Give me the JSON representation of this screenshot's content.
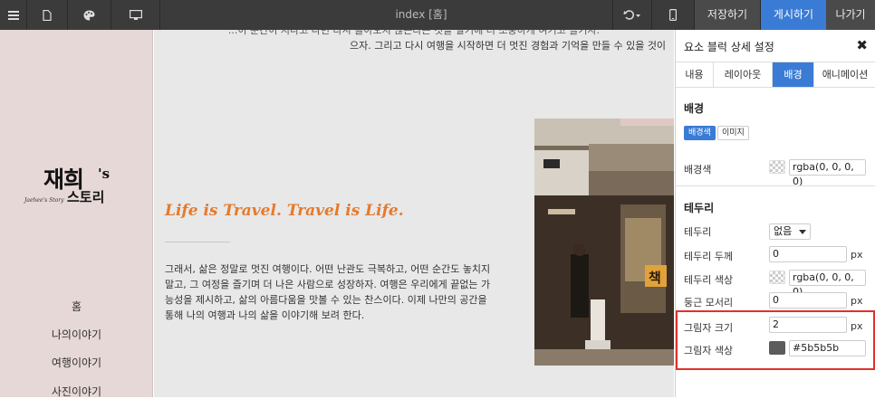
{
  "topbar": {
    "title": "index [홈]",
    "menu_icon": "hamburger-menu-icon",
    "page_icon": "document-icon",
    "palette_icon": "palette-icon",
    "desktop_icon": "monitor-icon",
    "undo_icon": "undo-icon",
    "mobile_icon": "mobile-phone-icon",
    "save_label": "저장하기",
    "publish_label": "게시하기",
    "exit_label": "나가기",
    "publish_color": "#3a7bd5"
  },
  "nav": {
    "logo_main": "재희",
    "logo_suffix": "'s",
    "logo_story": "스토리",
    "logo_script": "Jaehee's Story",
    "items": [
      "홈",
      "나의이야기",
      "여행이야기",
      "사진이야기"
    ]
  },
  "canvas": {
    "top_cut_text": "...이 순간이 지나고 나면 다시 돌아오지 않는다는 것을 알기에 더 소중하게 여기고 즐기자.",
    "top_line2": "으자. 그리고 다시 여행을 시작하면 더 멋진 경험과 기억을 만들 수 있을 것이",
    "headline": "Life is Travel. Travel is Life.",
    "headline_color": "#e57a2c",
    "body_lines": [
      "그래서, 삶은 정말로 멋진 여행이다. 어떤 난관도 극복하고, 어떤 순간도 놓치지",
      "말고, 그 여정을 즐기며 더 나은 사람으로 성장하자. 여행은 우리에게 끝없는 가",
      "능성을 제시하고, 삶의 아름다움을 맛볼 수 있는 찬스이다. 이제 나만의 공간을",
      "통해 나의 여행과 나의 삶을 이야기해 보려 한다."
    ],
    "photo_sign_text": "책"
  },
  "panel": {
    "title": "요소 블럭 상세 설정",
    "close_icon": "close-icon",
    "tabs": [
      "내용",
      "레이아웃",
      "배경",
      "애니메이션"
    ],
    "active_tab": "배경",
    "background": {
      "section_title": "배경",
      "chip_color": "배경색",
      "chip_image": "이미지",
      "color_label": "배경색",
      "color_value": "rgba(0, 0, 0, 0)"
    },
    "border": {
      "section_title": "테두리",
      "border_label": "테두리",
      "border_value": "없음",
      "width_label": "테두리 두께",
      "width_value": "0",
      "width_unit": "px",
      "color_label": "테두리 색상",
      "color_value": "rgba(0, 0, 0, 0)",
      "radius_label": "둥근 모서리",
      "radius_value": "0",
      "radius_unit": "px",
      "shadow_size_label": "그림자 크기",
      "shadow_size_value": "2",
      "shadow_size_unit": "px",
      "shadow_color_label": "그림자 색상",
      "shadow_color_value": "#5b5b5b"
    },
    "highlight_color": "#e0322b"
  }
}
